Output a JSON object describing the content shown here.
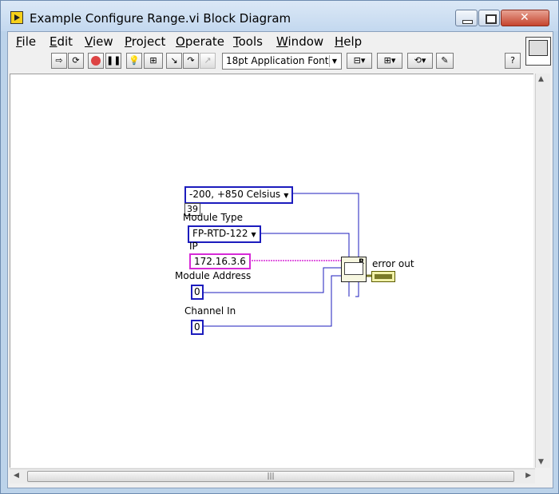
{
  "window": {
    "title": "Example Configure Range.vi Block Diagram"
  },
  "menu": [
    "File",
    "Edit",
    "View",
    "Project",
    "Operate",
    "Tools",
    "Window",
    "Help"
  ],
  "toolbar": {
    "font": "18pt Application Font"
  },
  "diagram": {
    "range_constant": "-200, +850 Celsius",
    "range_value_indicator": "39",
    "module_type_label": "Module Type",
    "module_type_value": "FP-RTD-122",
    "ip_label": "IP",
    "ip_value": "172.16.3.6",
    "module_address_label": "Module Address",
    "module_address_value": "0",
    "channel_in_label": "Channel In",
    "channel_in_value": "0",
    "error_out_label": "error out"
  },
  "colors": {
    "enum_wire": "#1c1cbd",
    "string_wire": "#d72ad7",
    "error_cluster": "#7a7a28"
  }
}
